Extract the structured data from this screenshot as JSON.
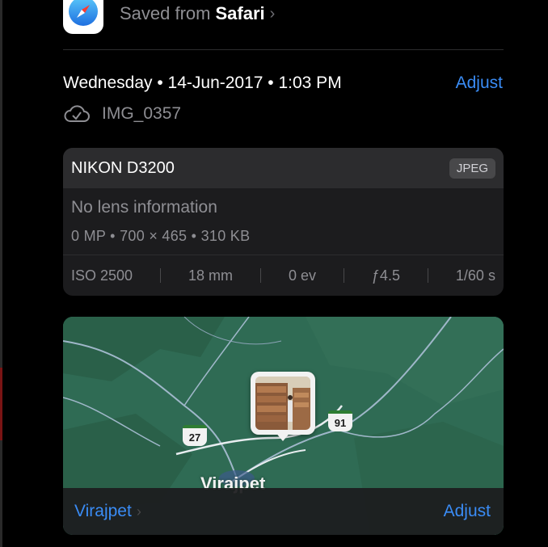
{
  "source": {
    "prefix": "Saved from",
    "app_name": "Safari",
    "chevron": "›",
    "icon": "safari-compass-icon"
  },
  "datetime": "Wednesday • 14-Jun-2017 • 1:03 PM",
  "adjust_datetime_label": "Adjust",
  "file": {
    "name": "IMG_0357",
    "icon": "icloud-check-icon"
  },
  "exif": {
    "camera": "NIKON D3200",
    "format_badge": "JPEG",
    "lens": "No lens information",
    "specs": "0 MP  •  700 × 465  •  310 KB",
    "settings": [
      "ISO 2500",
      "18 mm",
      "0 ev",
      "ƒ4.5",
      "1/60 s"
    ]
  },
  "map": {
    "routes": [
      "27",
      "91"
    ],
    "city_label": "Virajpet",
    "location_link": "Virajpet",
    "location_chevron": "›",
    "adjust_label": "Adjust"
  },
  "colors": {
    "accent": "#3a8cf5",
    "card_bg": "#1c1c1e",
    "card_header": "#2c2c2e",
    "map_land": "#2f6b54",
    "secondary_text": "#8e8e93"
  }
}
